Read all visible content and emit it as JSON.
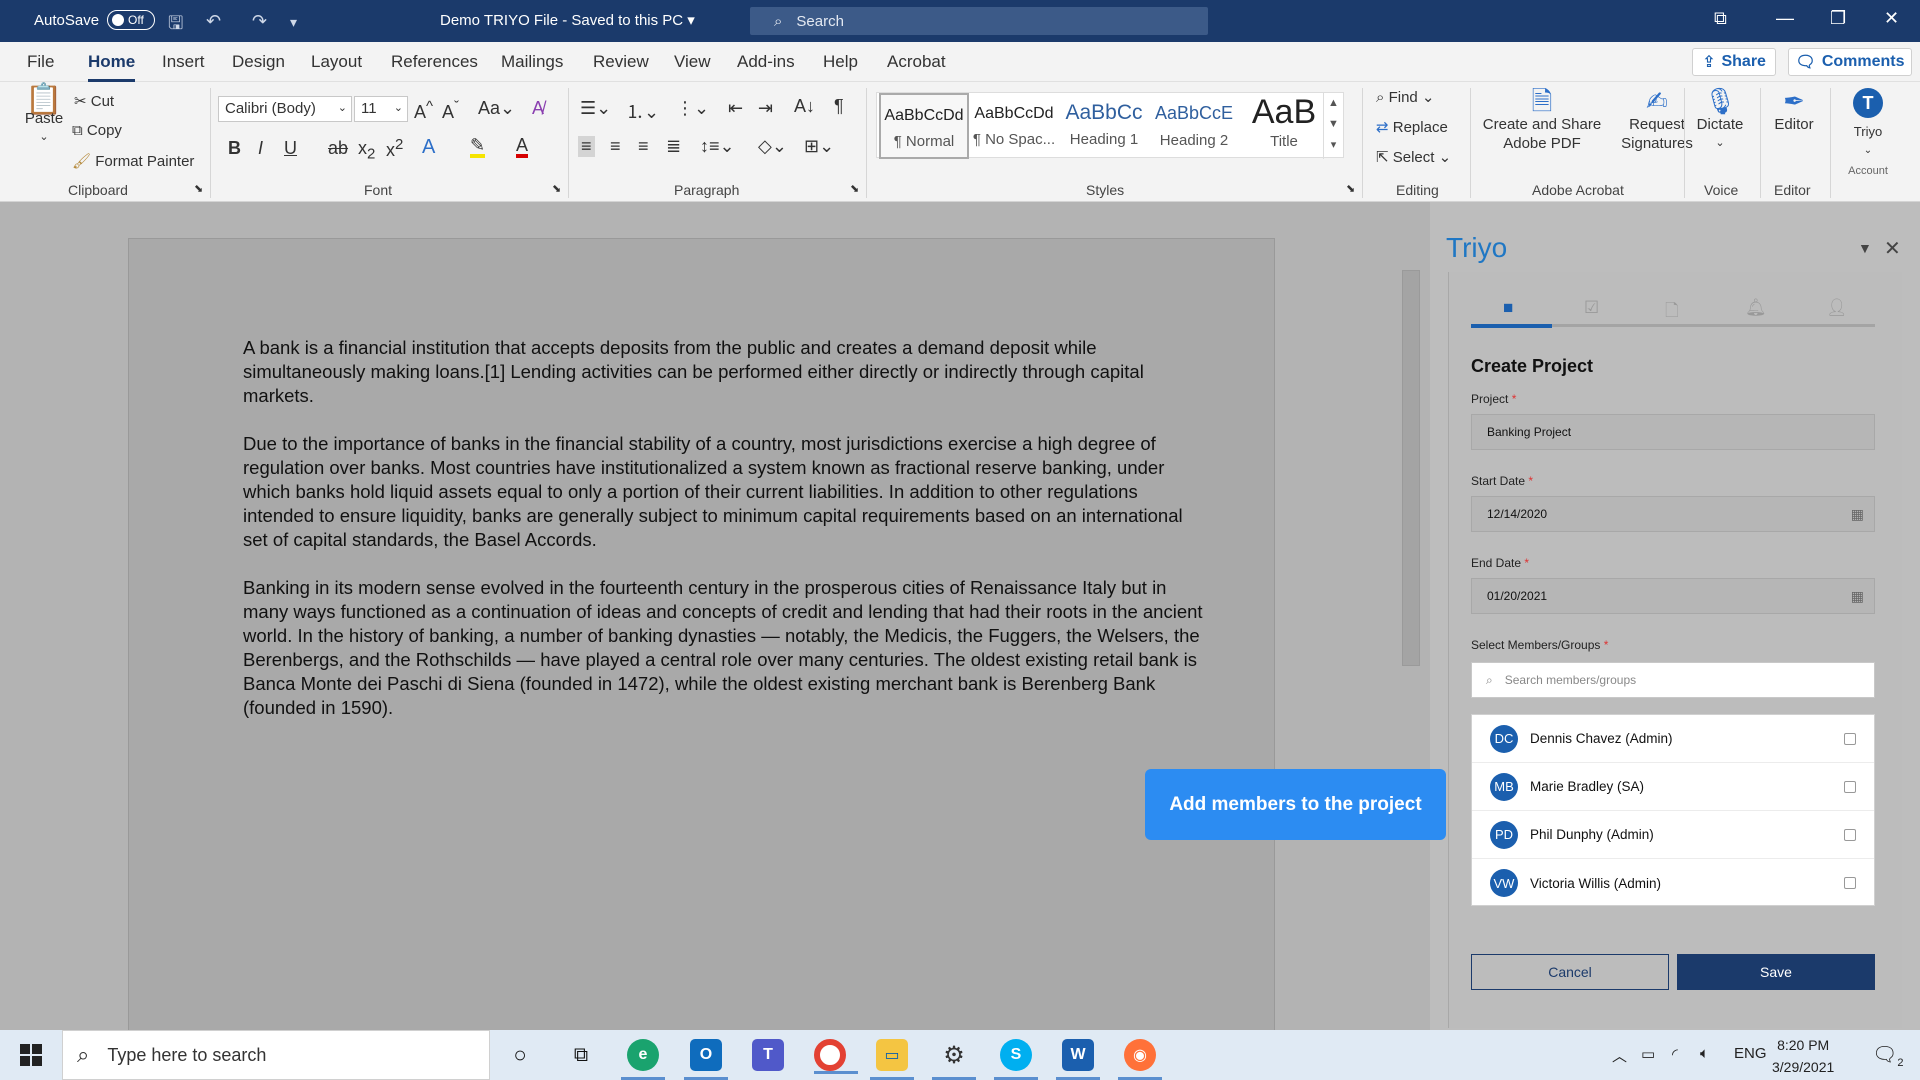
{
  "titlebar": {
    "autosave_label": "AutoSave",
    "autosave_state": "Off",
    "doc_title": "Demo TRIYO File  -  Saved to this PC",
    "search_placeholder": "Search"
  },
  "ribbon_tabs": [
    "File",
    "Home",
    "Insert",
    "Design",
    "Layout",
    "References",
    "Mailings",
    "Review",
    "View",
    "Add-ins",
    "Help",
    "Acrobat"
  ],
  "active_tab": "Home",
  "share_label": "Share",
  "comments_label": "Comments",
  "clipboard": {
    "paste": "Paste",
    "cut": "Cut",
    "copy": "Copy",
    "format_painter": "Format Painter",
    "group": "Clipboard"
  },
  "font": {
    "family": "Calibri (Body)",
    "size": "11",
    "group": "Font"
  },
  "paragraph": {
    "group": "Paragraph"
  },
  "styles": {
    "group": "Styles",
    "items": [
      {
        "sample": "AaBbCcDd",
        "name": "¶ Normal"
      },
      {
        "sample": "AaBbCcDd",
        "name": "¶ No Spac..."
      },
      {
        "sample": "AaBbCc",
        "name": "Heading 1"
      },
      {
        "sample": "AaBbCcE",
        "name": "Heading 2"
      },
      {
        "sample": "AaB",
        "name": "Title"
      }
    ]
  },
  "editing": {
    "find": "Find",
    "replace": "Replace",
    "select": "Select",
    "group": "Editing"
  },
  "acrobat": {
    "create_share_1": "Create and Share",
    "create_share_2": "Adobe PDF",
    "request_1": "Request",
    "request_2": "Signatures",
    "group": "Adobe Acrobat"
  },
  "voice": {
    "dictate": "Dictate",
    "group": "Voice"
  },
  "editor": {
    "label": "Editor",
    "group": "Editor"
  },
  "triyo_btn": {
    "label": "Triyo",
    "sub": "Account"
  },
  "document": {
    "paragraphs": [
      "A bank is a financial institution that accepts deposits from the public and creates a demand deposit while simultaneously making loans.[1] Lending activities can be performed either directly or indirectly through capital markets.",
      "Due to the importance of banks in the financial stability of a country, most jurisdictions exercise a high degree of regulation over banks. Most countries have institutionalized a system known as fractional reserve banking, under which banks hold liquid assets equal to only a portion of their current liabilities. In addition to other regulations intended to ensure liquidity, banks are generally subject to minimum capital requirements based on an international set of capital standards, the Basel Accords.",
      "Banking in its modern sense evolved in the fourteenth century in the prosperous cities of Renaissance Italy but in many ways functioned as a continuation of ideas and concepts of credit and lending that had their roots in the ancient world. In the history of banking, a number of banking dynasties — notably, the Medicis, the Fuggers, the Welsers, the Berenbergs, and the Rothschilds — have played a central role over many centuries. The oldest existing retail bank is Banca Monte dei Paschi di Siena (founded in 1472), while the oldest existing merchant bank is Berenberg Bank (founded in 1590)."
    ]
  },
  "pane": {
    "title": "Triyo",
    "section_title": "Create Project",
    "project_label": "Project",
    "project_value": "Banking Project",
    "start_label": "Start Date",
    "start_value": "12/14/2020",
    "end_label": "End Date",
    "end_value": "01/20/2021",
    "members_label": "Select Members/Groups",
    "members_placeholder": "Search members/groups",
    "members": [
      {
        "initials": "DC",
        "name": "Dennis Chavez (Admin)"
      },
      {
        "initials": "MB",
        "name": "Marie Bradley (SA)"
      },
      {
        "initials": "PD",
        "name": "Phil Dunphy (Admin)"
      },
      {
        "initials": "VW",
        "name": "Victoria Willis (Admin)"
      }
    ],
    "cancel": "Cancel",
    "save": "Save",
    "required_mark": "*"
  },
  "tooltip": "Add members to the project",
  "taskbar": {
    "search_placeholder": "Type here to search",
    "lang": "ENG",
    "time": "8:20 PM",
    "date": "3/29/2021",
    "notifications": "2"
  },
  "colors": {
    "accent": "#1b3a6b",
    "triyo_blue": "#1f77c4",
    "tooltip": "#2c8cf2"
  }
}
